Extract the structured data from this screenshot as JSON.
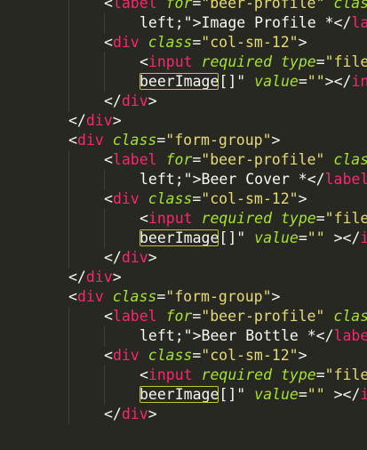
{
  "editor": {
    "theme_colors": {
      "background": "#272822",
      "tag": "#f92672",
      "attribute": "#a6e22e",
      "string": "#e6db74",
      "text": "#f8f8f2",
      "highlight_border": "#c9c232",
      "indent_guide": "#3e3f38"
    },
    "lines": [
      [
        [
          "punc",
          "<"
        ],
        [
          "tag",
          "label"
        ],
        [
          "txt",
          " "
        ],
        [
          "attr",
          "for"
        ],
        [
          "punc",
          "="
        ],
        [
          "str",
          "\"beer-profile\""
        ],
        [
          "txt",
          " "
        ],
        [
          "attr",
          "class"
        ]
      ],
      [
        [
          "txt",
          "left;\">Image Profile *</"
        ],
        [
          "tag",
          "la"
        ]
      ],
      [
        [
          "punc",
          "<"
        ],
        [
          "tag",
          "div"
        ],
        [
          "txt",
          " "
        ],
        [
          "attr",
          "class"
        ],
        [
          "punc",
          "="
        ],
        [
          "str",
          "\"col-sm-12\""
        ],
        [
          "punc",
          ">"
        ]
      ],
      [
        [
          "punc",
          "<"
        ],
        [
          "tag",
          "input"
        ],
        [
          "txt",
          " "
        ],
        [
          "attr",
          "required"
        ],
        [
          "txt",
          " "
        ],
        [
          "attr",
          "type"
        ],
        [
          "punc",
          "="
        ],
        [
          "str",
          "\"file"
        ]
      ],
      [
        [
          "hl",
          "beerImage"
        ],
        [
          "txt",
          "[]\" "
        ],
        [
          "attr",
          "value"
        ],
        [
          "punc",
          "="
        ],
        [
          "str",
          "\"\""
        ],
        [
          "punc",
          "></"
        ],
        [
          "tag",
          "in"
        ]
      ],
      [
        [
          "punc",
          "</"
        ],
        [
          "tag",
          "div"
        ],
        [
          "punc",
          ">"
        ]
      ],
      [
        [
          "punc",
          "</"
        ],
        [
          "tag",
          "div"
        ],
        [
          "punc",
          ">"
        ]
      ],
      [
        [
          "punc",
          "<"
        ],
        [
          "tag",
          "div"
        ],
        [
          "txt",
          " "
        ],
        [
          "attr",
          "class"
        ],
        [
          "punc",
          "="
        ],
        [
          "str",
          "\"form-group\""
        ],
        [
          "punc",
          ">"
        ]
      ],
      [
        [
          "punc",
          "<"
        ],
        [
          "tag",
          "label"
        ],
        [
          "txt",
          " "
        ],
        [
          "attr",
          "for"
        ],
        [
          "punc",
          "="
        ],
        [
          "str",
          "\"beer-profile\""
        ],
        [
          "txt",
          " "
        ],
        [
          "attr",
          "class"
        ]
      ],
      [
        [
          "txt",
          "left;\">Beer Cover *</"
        ],
        [
          "tag",
          "label"
        ]
      ],
      [
        [
          "punc",
          "<"
        ],
        [
          "tag",
          "div"
        ],
        [
          "txt",
          " "
        ],
        [
          "attr",
          "class"
        ],
        [
          "punc",
          "="
        ],
        [
          "str",
          "\"col-sm-12\""
        ],
        [
          "punc",
          ">"
        ]
      ],
      [
        [
          "punc",
          "<"
        ],
        [
          "tag",
          "input"
        ],
        [
          "txt",
          " "
        ],
        [
          "attr",
          "required"
        ],
        [
          "txt",
          " "
        ],
        [
          "attr",
          "type"
        ],
        [
          "punc",
          "="
        ],
        [
          "str",
          "\"file"
        ]
      ],
      [
        [
          "hl",
          "beerImage"
        ],
        [
          "txt",
          "[]\" "
        ],
        [
          "attr",
          "value"
        ],
        [
          "punc",
          "="
        ],
        [
          "str",
          "\"\""
        ],
        [
          "txt",
          " "
        ],
        [
          "punc",
          "></"
        ],
        [
          "tag",
          "i"
        ]
      ],
      [
        [
          "punc",
          "</"
        ],
        [
          "tag",
          "div"
        ],
        [
          "punc",
          ">"
        ]
      ],
      [
        [
          "punc",
          "</"
        ],
        [
          "tag",
          "div"
        ],
        [
          "punc",
          ">"
        ]
      ],
      [
        [
          "punc",
          "<"
        ],
        [
          "tag",
          "div"
        ],
        [
          "txt",
          " "
        ],
        [
          "attr",
          "class"
        ],
        [
          "punc",
          "="
        ],
        [
          "str",
          "\"form-group\""
        ],
        [
          "punc",
          ">"
        ]
      ],
      [
        [
          "punc",
          "<"
        ],
        [
          "tag",
          "label"
        ],
        [
          "txt",
          " "
        ],
        [
          "attr",
          "for"
        ],
        [
          "punc",
          "="
        ],
        [
          "str",
          "\"beer-profile\""
        ],
        [
          "txt",
          " "
        ],
        [
          "attr",
          "class"
        ]
      ],
      [
        [
          "txt",
          "left;\">Beer Bottle *</"
        ],
        [
          "tag",
          "labe"
        ]
      ],
      [
        [
          "punc",
          "<"
        ],
        [
          "tag",
          "div"
        ],
        [
          "txt",
          " "
        ],
        [
          "attr",
          "class"
        ],
        [
          "punc",
          "="
        ],
        [
          "str",
          "\"col-sm-12\""
        ],
        [
          "punc",
          ">"
        ]
      ],
      [
        [
          "punc",
          "<"
        ],
        [
          "tag",
          "input"
        ],
        [
          "txt",
          " "
        ],
        [
          "attr",
          "required"
        ],
        [
          "txt",
          " "
        ],
        [
          "attr",
          "type"
        ],
        [
          "punc",
          "="
        ],
        [
          "str",
          "\"file"
        ]
      ],
      [
        [
          "hl",
          "beerImage"
        ],
        [
          "txt",
          "[]\" "
        ],
        [
          "attr",
          "value"
        ],
        [
          "punc",
          "="
        ],
        [
          "str",
          "\"\""
        ],
        [
          "txt",
          " "
        ],
        [
          "punc",
          "></"
        ],
        [
          "tag",
          "i"
        ]
      ],
      [
        [
          "punc",
          "</"
        ],
        [
          "tag",
          "div"
        ],
        [
          "punc",
          ">"
        ]
      ]
    ]
  }
}
